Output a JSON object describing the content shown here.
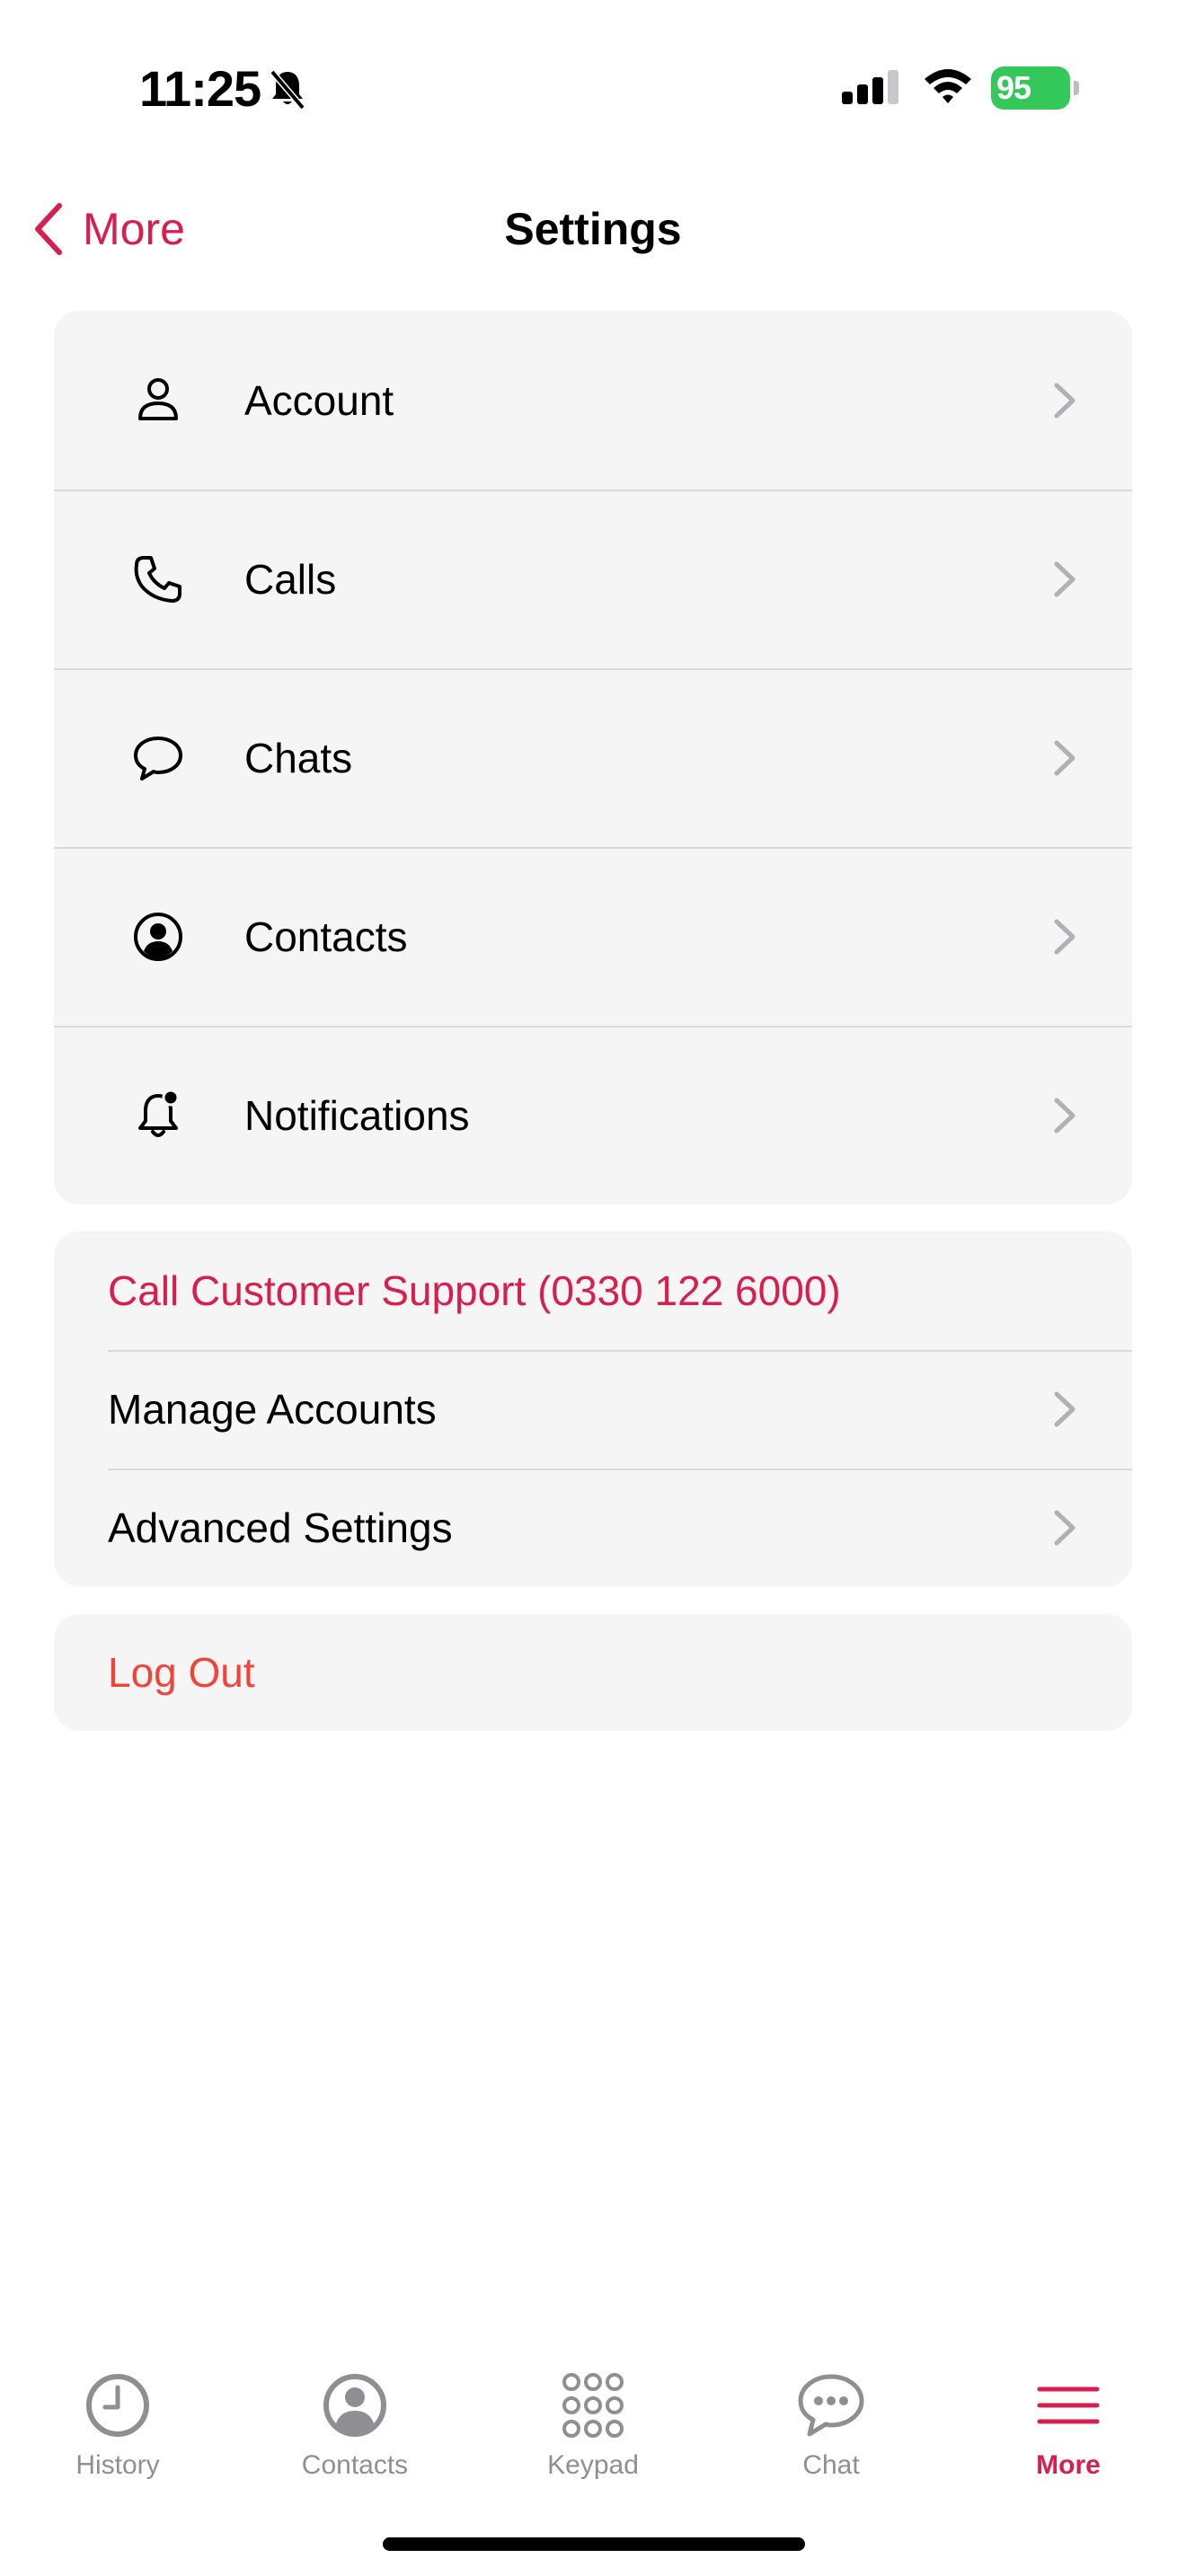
{
  "status_bar": {
    "time": "11:25",
    "battery": "95",
    "battery_color": "#34c759"
  },
  "nav": {
    "back_label": "More",
    "title": "Settings"
  },
  "settings_items": [
    {
      "label": "Account",
      "icon": "person-icon"
    },
    {
      "label": "Calls",
      "icon": "phone-icon"
    },
    {
      "label": "Chats",
      "icon": "chat-bubble-icon"
    },
    {
      "label": "Contacts",
      "icon": "contact-circle-icon"
    },
    {
      "label": "Notifications",
      "icon": "bell-badge-icon"
    }
  ],
  "support_group": {
    "call_support": "Call Customer Support (0330 122 6000)",
    "manage_accounts": "Manage Accounts",
    "advanced_settings": "Advanced Settings"
  },
  "logout": {
    "label": "Log Out"
  },
  "tabs": [
    {
      "label": "History",
      "icon": "clock-icon",
      "active": false
    },
    {
      "label": "Contacts",
      "icon": "contact-circle-icon",
      "active": false
    },
    {
      "label": "Keypad",
      "icon": "keypad-icon",
      "active": false
    },
    {
      "label": "Chat",
      "icon": "chat-bubble-icon",
      "active": false
    },
    {
      "label": "More",
      "icon": "menu-icon",
      "active": true
    }
  ],
  "colors": {
    "accent": "#d81e4c",
    "destructive": "#f04438",
    "inactive_tab": "#8e8e93",
    "group_background": "#f5f5f5"
  }
}
